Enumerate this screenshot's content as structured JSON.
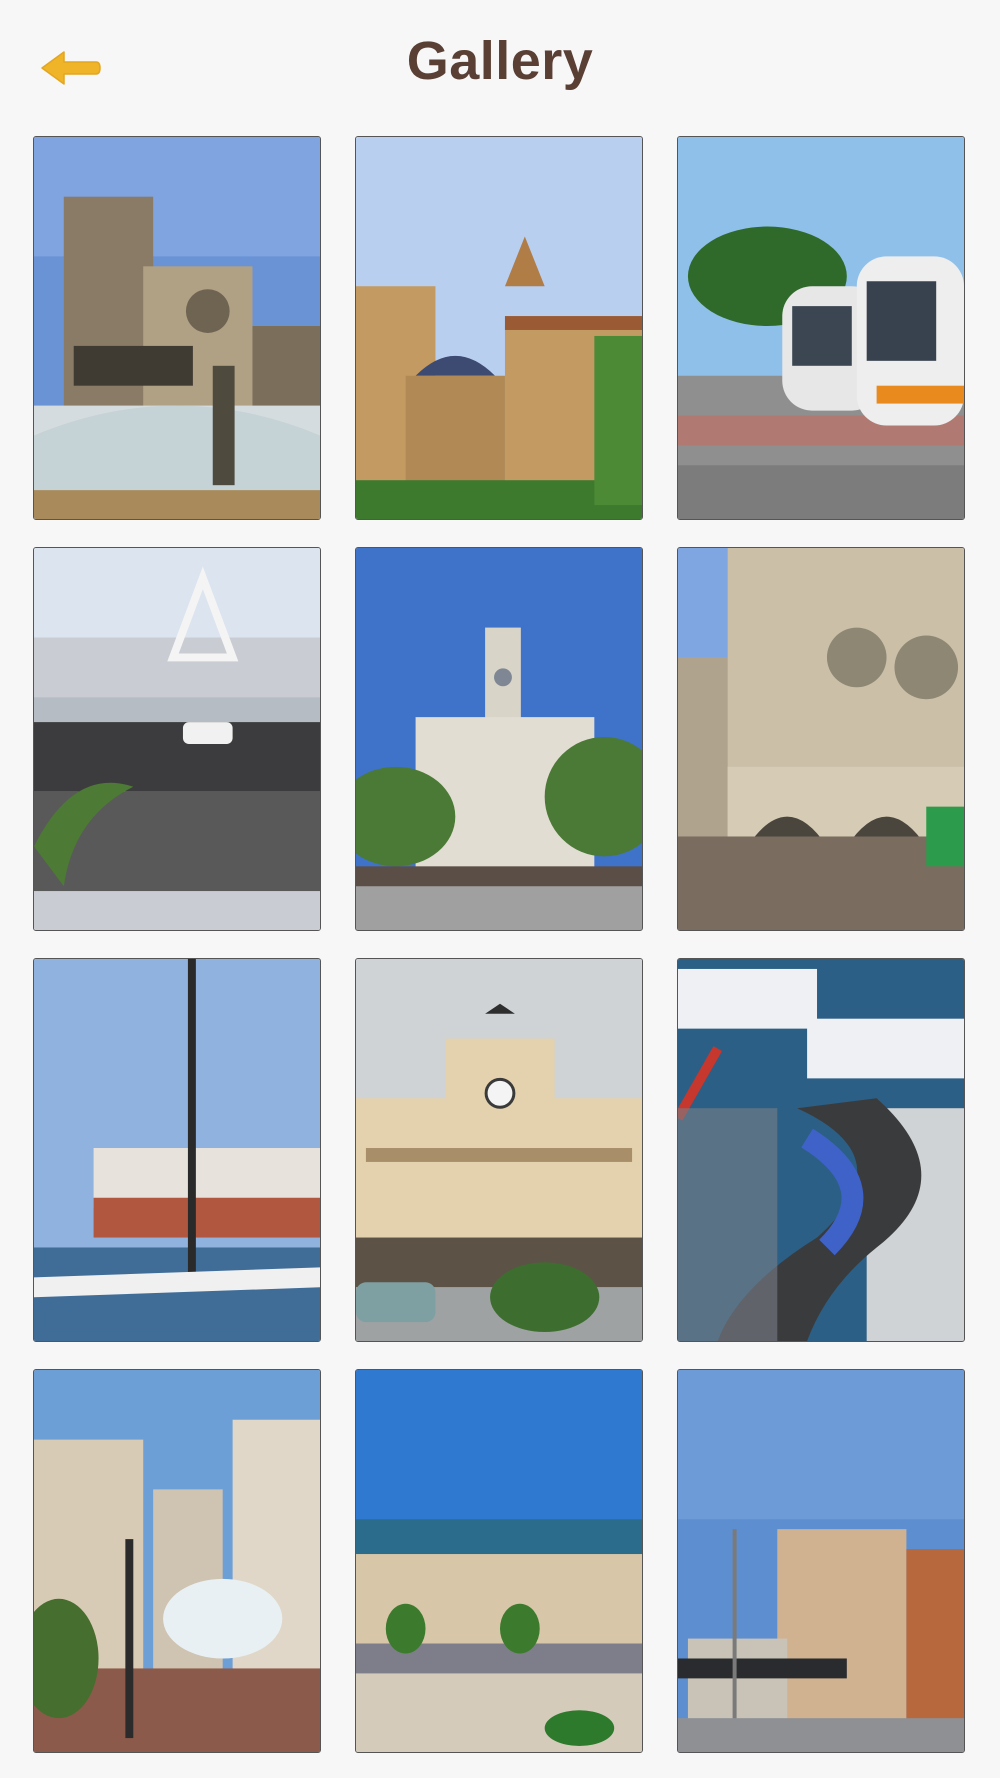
{
  "header": {
    "title": "Gallery",
    "back_icon": "arrow-left-icon",
    "accent": "#f0b429",
    "title_color": "#5a3f35"
  },
  "gallery": {
    "photos": [
      {
        "subject": "cathedral-fountain"
      },
      {
        "subject": "cathedral-towers"
      },
      {
        "subject": "tram"
      },
      {
        "subject": "race-circuit-bridge"
      },
      {
        "subject": "city-hall-square"
      },
      {
        "subject": "central-market"
      },
      {
        "subject": "harbor-catamaran"
      },
      {
        "subject": "north-station"
      },
      {
        "subject": "street-circuit-start"
      },
      {
        "subject": "plaza-fountain"
      },
      {
        "subject": "beach"
      },
      {
        "subject": "apartment-block"
      }
    ]
  }
}
